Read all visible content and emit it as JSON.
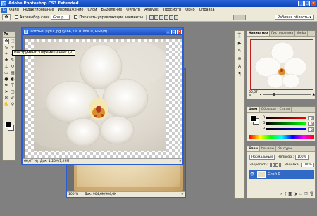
{
  "window": {
    "title": "Adobe Photoshop CS3 Extended",
    "app_icon": "Ps"
  },
  "menu": [
    "Файл",
    "Редактирование",
    "Изображение",
    "Слой",
    "Выделение",
    "Фильтр",
    "Analysis",
    "Просмотр",
    "Окно",
    "Справка"
  ],
  "options": {
    "tool_icon": "move-tool-icon",
    "auto_select_label": "Автовыбор слоя",
    "group_value": "Group",
    "show_controls_label": "Показать управляющие элементы",
    "workspace_label": "Рабочая область ▾"
  },
  "toolbox": {
    "header": "Ps"
  },
  "tooltip": "Инструмент \"Перемещение\" (V)",
  "doc_photo": {
    "title": "ФотоьоГруп1.jpg @ 66,7% (Слой 0, RGB/8)",
    "zoom": "66,67 %",
    "status": "Док: 1,20M/1,29M"
  },
  "doc_parchment": {
    "zoom": "100 %",
    "status": "Док: 904,6K/904,6K"
  },
  "navigator": {
    "tabs": [
      "Навигатор",
      "Гистограмма",
      "Инфо"
    ],
    "zoom": "66,67 %"
  },
  "color_panel": {
    "tabs": [
      "Цвет",
      "Образцы",
      "Стили"
    ],
    "rows": [
      {
        "label": "R",
        "value": "0"
      },
      {
        "label": "G",
        "value": "0"
      },
      {
        "label": "B",
        "value": "0"
      }
    ]
  },
  "layers_panel": {
    "tabs": [
      "Слои",
      "Каналы",
      "Контуры"
    ],
    "blend_mode": "Нормальный",
    "opacity_label": "Непрозр.:",
    "opacity_value": "100%",
    "lock_label": "Закрепить:",
    "fill_label": "Заливка:",
    "fill_value": "100%",
    "layer_name": "Слой 0"
  },
  "colors": {
    "title_blue": "#0c45b6",
    "panel_bg": "#ece9d8",
    "selected_layer": "#3169c6"
  }
}
